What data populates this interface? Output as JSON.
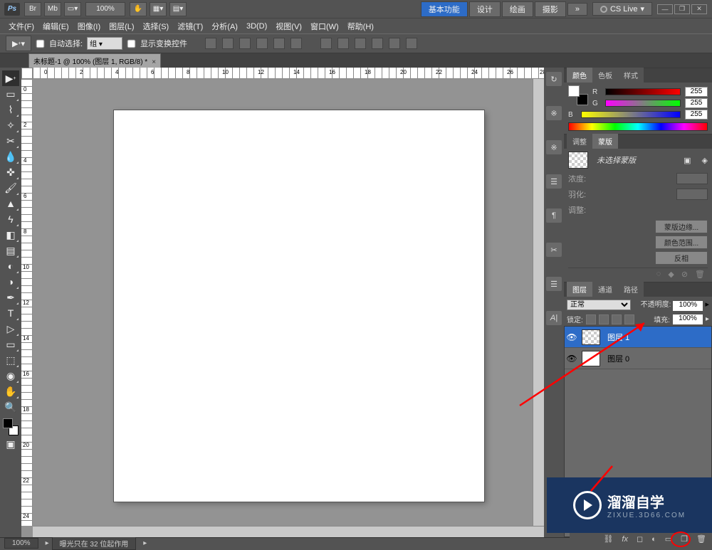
{
  "app": {
    "logo": "Ps",
    "zoom_combo": "100%",
    "workspaces": [
      "基本功能",
      "设计",
      "绘画",
      "摄影"
    ],
    "more": "»",
    "cslive": "CS Live"
  },
  "menu": [
    "文件(F)",
    "编辑(E)",
    "图像(I)",
    "图层(L)",
    "选择(S)",
    "滤镜(T)",
    "分析(A)",
    "3D(D)",
    "视图(V)",
    "窗口(W)",
    "帮助(H)"
  ],
  "options": {
    "auto_select": "自动选择:",
    "auto_select_val": "组",
    "show_transform": "显示变换控件"
  },
  "doc": {
    "tab": "未标题-1 @ 100% (图层 1, RGB/8) *"
  },
  "color": {
    "tabs": [
      "颜色",
      "色板",
      "样式"
    ],
    "channels": [
      {
        "label": "R",
        "value": "255"
      },
      {
        "label": "G",
        "value": "255"
      },
      {
        "label": "B",
        "value": "255"
      }
    ]
  },
  "mask": {
    "tabs": [
      "调整",
      "蒙版"
    ],
    "none_msg": "未选择蒙版",
    "rows": [
      {
        "label": "浓度:"
      },
      {
        "label": "羽化:"
      }
    ],
    "group": "调整:",
    "btns": [
      "蒙版边缘...",
      "颜色范围...",
      "反相"
    ]
  },
  "layers": {
    "tabs": [
      "图层",
      "通道",
      "路径"
    ],
    "mode": "正常",
    "opacity_label": "不透明度:",
    "opacity_val": "100%",
    "lock_label": "锁定:",
    "fill_label": "填充:",
    "fill_val": "100%",
    "items": [
      {
        "name": "图层 1",
        "selected": true,
        "trans": true
      },
      {
        "name": "图层 0",
        "selected": false,
        "trans": false
      }
    ]
  },
  "status": {
    "zoom": "100%",
    "info": "曝光只在 32 位起作用"
  },
  "watermark": {
    "title": "溜溜自学",
    "sub": "ZIXUE.3D66.COM"
  }
}
